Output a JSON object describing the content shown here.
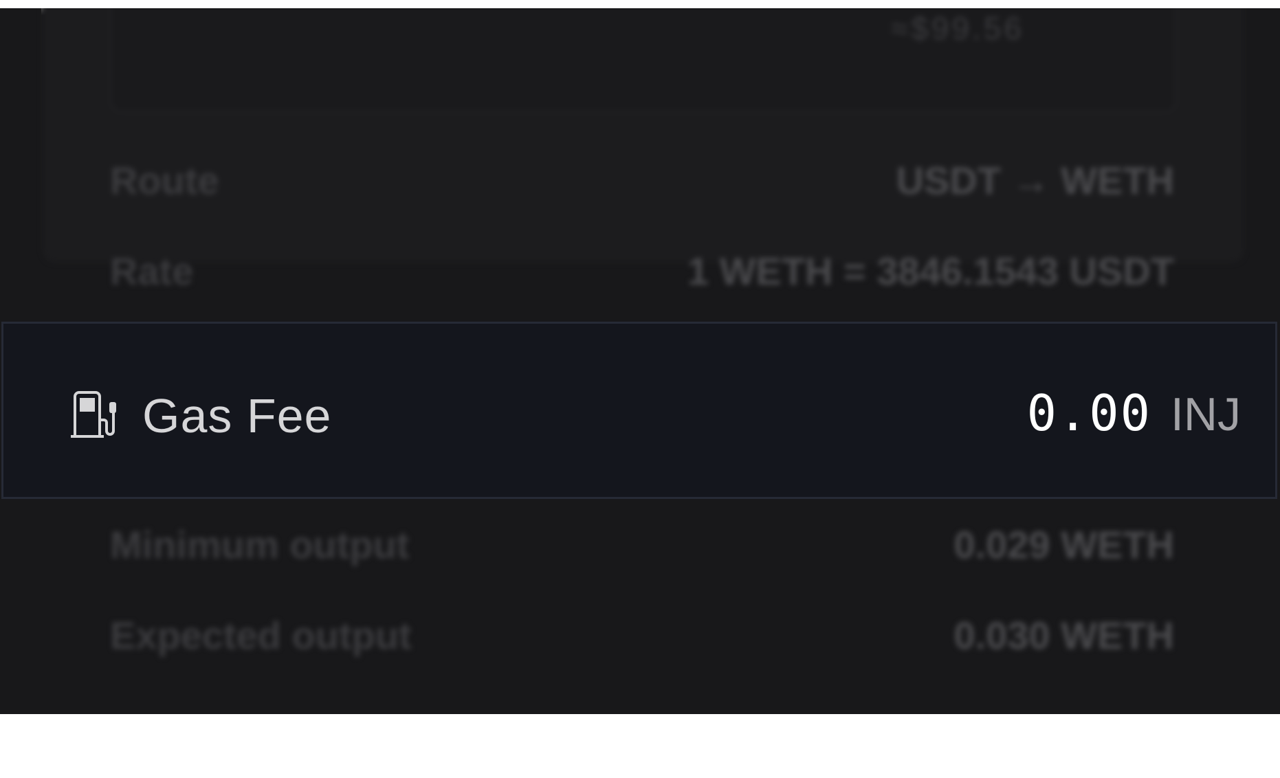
{
  "swap_summary": {
    "usd_value": "≈$99.56",
    "route": {
      "label": "Route",
      "value": "USDT → WETH"
    },
    "rate": {
      "label": "Rate",
      "value": "1 WETH = 3846.1543 USDT"
    },
    "gas_fee": {
      "label": "Gas Fee",
      "amount": "0.00",
      "unit": "INJ",
      "icon": "gas-pump-icon"
    },
    "minimum_output": {
      "label": "Minimum output",
      "value": "0.029 WETH"
    },
    "expected_output": {
      "label": "Expected output",
      "value": "0.030 WETH"
    }
  },
  "colors": {
    "background": "#18181a",
    "highlight_background": "#14161d",
    "highlight_border": "#262a36",
    "gas_amount": "#ffffff",
    "gas_unit": "#a2a2a6"
  }
}
